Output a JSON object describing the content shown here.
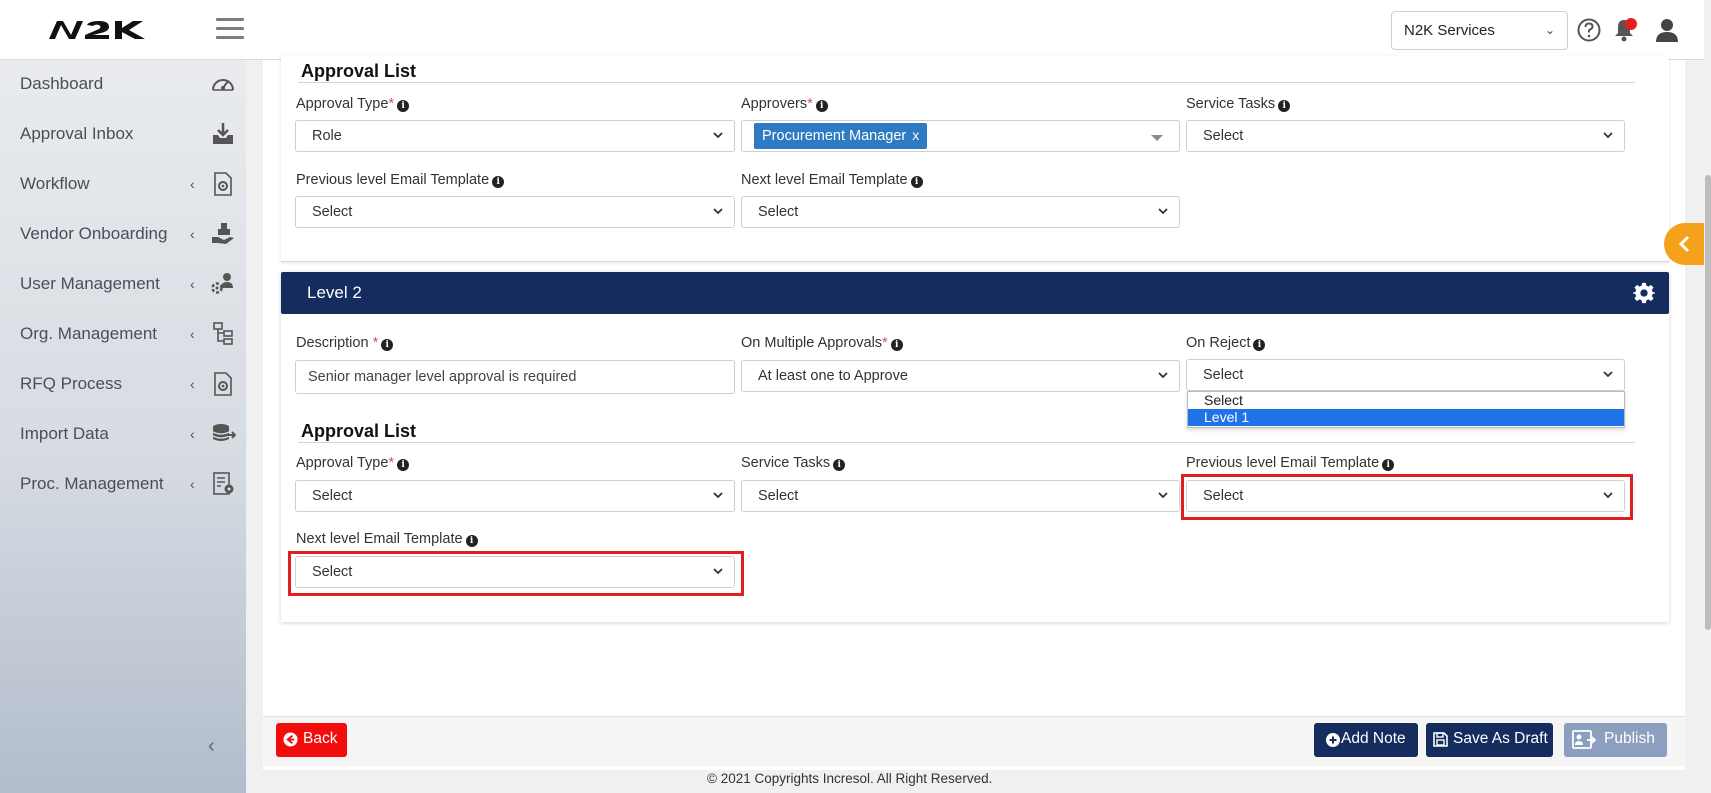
{
  "header": {
    "logo_text": "N2K",
    "org_select": "N2K Services"
  },
  "sidebar": {
    "items": [
      {
        "label": "Dashboard",
        "icon": "gauge-icon",
        "has_children": false
      },
      {
        "label": "Approval Inbox",
        "icon": "inbox-download-icon",
        "has_children": false
      },
      {
        "label": "Workflow",
        "icon": "document-gear-icon",
        "has_children": true
      },
      {
        "label": "Vendor Onboarding",
        "icon": "hand-boxes-icon",
        "has_children": true
      },
      {
        "label": "User Management",
        "icon": "users-gear-icon",
        "has_children": true
      },
      {
        "label": "Org. Management",
        "icon": "hierarchy-icon",
        "has_children": true
      },
      {
        "label": "RFQ Process",
        "icon": "document-gear-icon",
        "has_children": true
      },
      {
        "label": "Import Data",
        "icon": "database-import-icon",
        "has_children": true
      },
      {
        "label": "Proc. Management",
        "icon": "document-settings-icon",
        "has_children": true
      }
    ]
  },
  "level1": {
    "approval_list_title": "Approval List",
    "approval_type_label": "Approval Type",
    "approval_type_value": "Role",
    "approvers_label": "Approvers",
    "approvers_tag": "Procurement Manager",
    "approvers_tag_remove": "x",
    "service_tasks_label": "Service Tasks",
    "service_tasks_value": "Select",
    "prev_email_label": "Previous level Email Template",
    "prev_email_value": "Select",
    "next_email_label": "Next level Email Template",
    "next_email_value": "Select"
  },
  "level2": {
    "title": "Level 2",
    "description_label": "Description ",
    "description_value": "Senior manager level approval is required",
    "multiple_approvals_label": "On Multiple Approvals",
    "multiple_approvals_value": "At least one to Approve",
    "on_reject_label": "On Reject",
    "on_reject_value": "Select",
    "on_reject_options": [
      "Select",
      "Level 1"
    ],
    "approval_list_title": "Approval List",
    "approval_type_label": "Approval Type",
    "approval_type_value": "Select",
    "service_tasks_label": "Service Tasks",
    "service_tasks_value": "Select",
    "prev_email_label": "Previous level Email Template",
    "prev_email_value": "Select",
    "next_email_label": "Next level Email Template",
    "next_email_value": "Select"
  },
  "footer": {
    "back": "Back",
    "add_note": "Add Note",
    "save_draft": "Save As Draft",
    "publish": "Publish",
    "copyright": "© 2021 Copyrights Incresol. All Right Reserved."
  },
  "colors": {
    "navy": "#152c5f",
    "back_red": "#f20c0c",
    "highlight_red": "#e02020",
    "tag_blue": "#2e7bc4",
    "accent_orange": "#f4a11c"
  }
}
